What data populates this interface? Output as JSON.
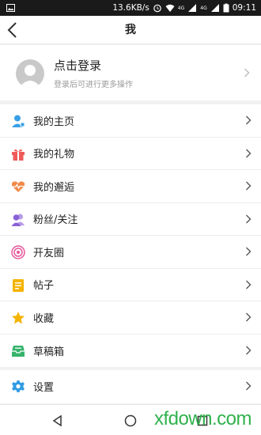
{
  "status_bar": {
    "speed": "13.6KB/s",
    "network_1": "4G",
    "network_2": "4G",
    "time": "09:11",
    "icons": [
      "image-icon",
      "alarm-icon",
      "wifi-icon",
      "signal-icon",
      "signal-icon",
      "battery-icon"
    ]
  },
  "header": {
    "title": "我",
    "back_icon": "back-arrow-icon"
  },
  "profile": {
    "name": "点击登录",
    "hint": "登录后可进行更多操作",
    "avatar_icon": "default-avatar-icon"
  },
  "menu_group_1": [
    {
      "label": "我的主页",
      "icon": "user-home-icon",
      "color": "#3aa0e6"
    },
    {
      "label": "我的礼物",
      "icon": "gift-icon",
      "color": "#ef5a5a"
    },
    {
      "label": "我的邂逅",
      "icon": "heart-pulse-icon",
      "color": "#f08a4b"
    },
    {
      "label": "粉丝/关注",
      "icon": "followers-icon",
      "color": "#8a62d6"
    },
    {
      "label": "开友圈",
      "icon": "circle-icon",
      "color": "#e8559a"
    },
    {
      "label": "帖子",
      "icon": "post-icon",
      "color": "#f4b400"
    },
    {
      "label": "收藏",
      "icon": "star-icon",
      "color": "#f4b400"
    },
    {
      "label": "草稿箱",
      "icon": "draft-box-icon",
      "color": "#35b36b"
    }
  ],
  "menu_group_2": [
    {
      "label": "设置",
      "icon": "gear-icon",
      "color": "#2f9be3"
    }
  ],
  "nav_bar": {
    "icons": [
      "nav-back-icon",
      "nav-home-icon",
      "nav-recents-icon"
    ]
  },
  "watermark": "xfdown.com"
}
